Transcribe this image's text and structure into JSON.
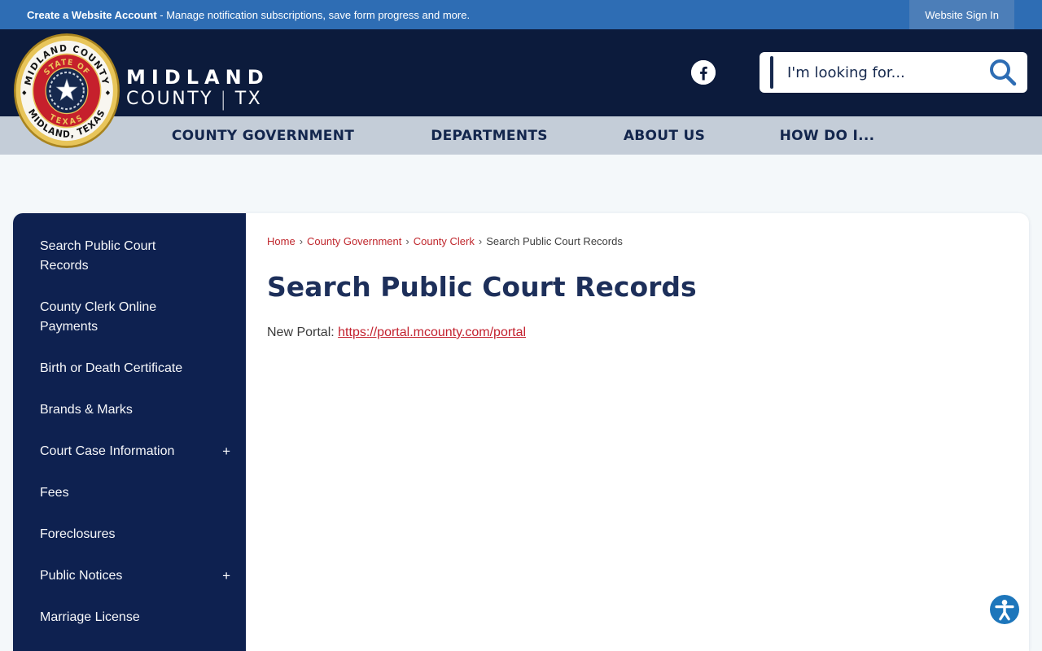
{
  "topbar": {
    "account_link": "Create a Website Account",
    "account_tagline": " - Manage notification subscriptions, save form progress and more.",
    "signin_button": "Website Sign In"
  },
  "header": {
    "logo": {
      "line1": "MIDLAND",
      "line2_word": "COUNTY",
      "line2_divider": "|",
      "line2_state": "TX"
    },
    "seal": {
      "ring_top": "MIDLAND COUNTY",
      "ring_bottom": "MIDLAND, TEXAS",
      "inner_top": "STATE OF",
      "inner_bottom": "TEXAS"
    },
    "search": {
      "placeholder": "I'm looking for..."
    }
  },
  "nav": {
    "items": [
      {
        "label": "COUNTY GOVERNMENT"
      },
      {
        "label": "DEPARTMENTS"
      },
      {
        "label": "ABOUT US"
      },
      {
        "label": "HOW DO I..."
      }
    ]
  },
  "sidebar": {
    "expand_glyph": "+",
    "items": [
      {
        "label": "Search Public Court Records",
        "expandable": false
      },
      {
        "label": "County Clerk Online Payments",
        "expandable": false
      },
      {
        "label": "Birth or Death Certificate",
        "expandable": false
      },
      {
        "label": "Brands & Marks",
        "expandable": false
      },
      {
        "label": "Court Case Information",
        "expandable": true
      },
      {
        "label": "Fees",
        "expandable": false
      },
      {
        "label": "Foreclosures",
        "expandable": false
      },
      {
        "label": "Public Notices",
        "expandable": true
      },
      {
        "label": "Marriage License",
        "expandable": false
      }
    ]
  },
  "breadcrumb": {
    "separator": "›",
    "items": [
      {
        "label": "Home",
        "current": false
      },
      {
        "label": "County Government",
        "current": false
      },
      {
        "label": "County Clerk",
        "current": false
      },
      {
        "label": "Search Public Court Records",
        "current": true
      }
    ]
  },
  "main": {
    "title": "Search Public Court Records",
    "portal_label": "New Portal:",
    "portal_url": "https://portal.mcounty.com/portal"
  },
  "colors": {
    "topbar_blue": "#2e6db4",
    "signin_blue": "#4c7eb8",
    "header_navy": "#0c1b3c",
    "nav_gray": "#c4cdd8",
    "sidebar_navy": "#0e2150",
    "title_navy": "#1d2f5a",
    "link_red": "#c3212e",
    "breadcrumb_red": "#c0272d",
    "search_accent_navy": "#16294e",
    "search_icon_blue": "#2e6db4",
    "accessibility_blue": "#1d76bb",
    "seal_gold": "#e8c55a",
    "seal_red": "#c6202c",
    "page_bg": "#f4f8fa"
  }
}
